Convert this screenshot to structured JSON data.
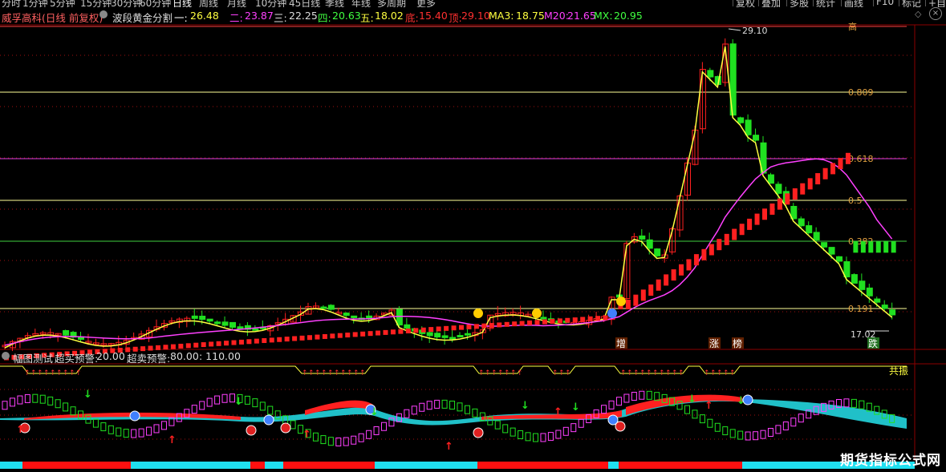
{
  "toolbar": {
    "periods": [
      "分时",
      "1分钟",
      "5分钟",
      "15分钟",
      "30分钟",
      "60分钟",
      "日线",
      "周线",
      "月线",
      "10分钟",
      "45日线",
      "季线",
      "年线",
      "多周期",
      "更多"
    ],
    "active_period": "日线",
    "right_buttons": [
      "复权",
      "叠加",
      "多股",
      "统计",
      "画线",
      "F10",
      "标记",
      "+自选"
    ]
  },
  "main_header": {
    "stock": "威孚高科(日线 前复权)",
    "indicator": "波段黄金分割",
    "one_label": "一:",
    "one": "26.48",
    "two_label": "二:",
    "two": "23.87",
    "three_label": "三:",
    "three": "22.25",
    "four_label": "四:",
    "four": "20.63",
    "five_label": "五:",
    "five": "18.02",
    "bottom_label": "底:",
    "bottom": "15.40",
    "top_label": "顶:",
    "top": "29.10",
    "ma3_label": "MA3:",
    "ma3": "18.75",
    "m20_label": "M20:",
    "m20": "21.65",
    "mx_label": "MX:",
    "mx": "20.95"
  },
  "fib_levels": [
    {
      "label": "高",
      "value": 29.1
    },
    {
      "label": "0.809",
      "value": 26.48
    },
    {
      "label": "0.618",
      "value": 23.87
    },
    {
      "label": "0.5",
      "value": 22.25
    },
    {
      "label": "0.382",
      "value": 20.63
    },
    {
      "label": "0.191",
      "value": 18.02
    }
  ],
  "price_annotations": {
    "high": "29.10",
    "low": "17.02"
  },
  "event_tags": [
    "增",
    "涨",
    "榜",
    "跌"
  ],
  "sub_header": {
    "title": "幅图测试",
    "overbuy_label": "超买预警:",
    "overbuy": "20.00",
    "oversell_label": "超卖预警:",
    "oversell": "80.00",
    "extra": ": 110.00"
  },
  "resonance": "共振",
  "watermark": "期货指标公式网",
  "colors": {
    "up": "#ff2020",
    "down": "#20e020",
    "yellow": "#ffff40",
    "magenta": "#ff40ff",
    "cyan": "#20c0c8",
    "fib_yellow": "#ffff99",
    "fib_magenta": "#e040e0",
    "fib_green": "#40ff40",
    "grid_red": "#a01010"
  }
}
